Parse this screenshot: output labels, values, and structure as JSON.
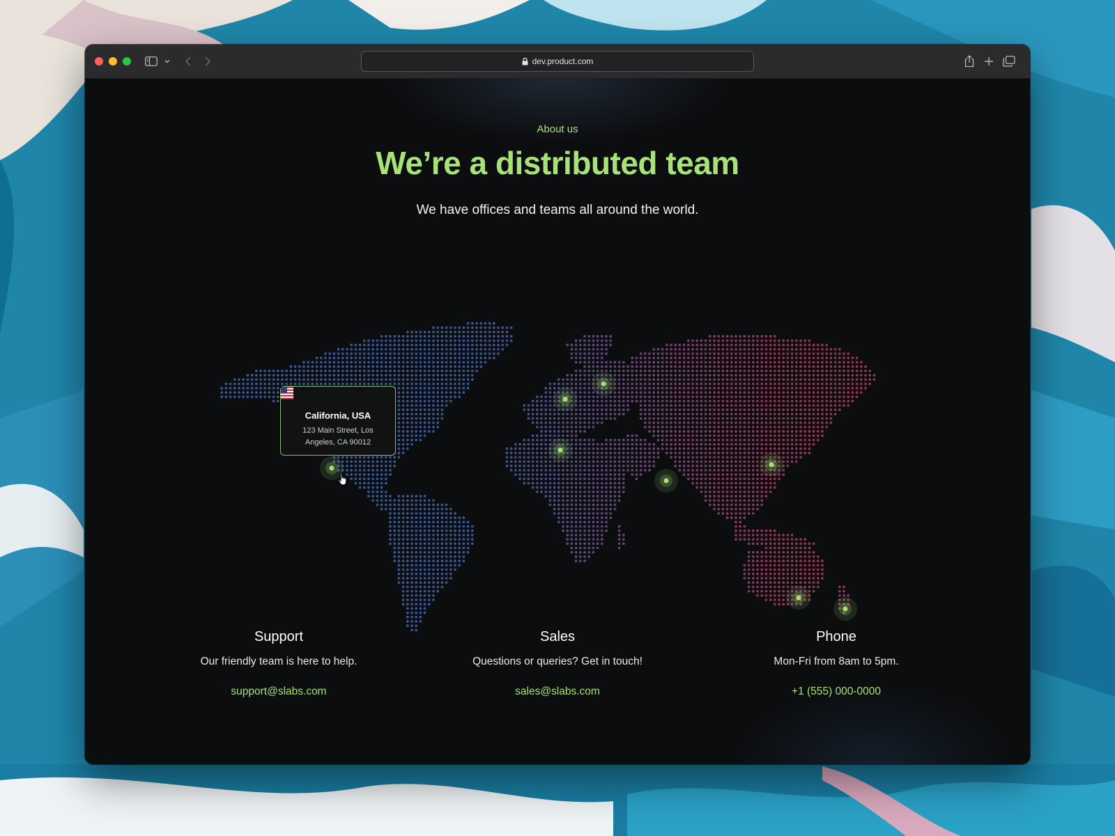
{
  "browser": {
    "url": "dev.product.com"
  },
  "hero": {
    "eyebrow": "About us",
    "title": "We’re a distributed team",
    "subtitle": "We have offices and teams all around the world."
  },
  "map": {
    "colors": {
      "west": "#3c5d9e",
      "east": "#9a3a5c",
      "marker": "#a6e278"
    },
    "tooltip": {
      "flag_icon": "us-flag-icon",
      "city": "California, USA",
      "address": "123 Main Street, Los Angeles, CA 90012"
    },
    "offices": [
      {
        "id": "california"
      },
      {
        "id": "uk"
      },
      {
        "id": "scandinavia"
      },
      {
        "id": "spain"
      },
      {
        "id": "india"
      },
      {
        "id": "china"
      },
      {
        "id": "australia"
      },
      {
        "id": "new-zealand"
      }
    ]
  },
  "contacts": [
    {
      "title": "Support",
      "description": "Our friendly team is here to help.",
      "link": "support@slabs.com"
    },
    {
      "title": "Sales",
      "description": "Questions or queries? Get in touch!",
      "link": "sales@slabs.com"
    },
    {
      "title": "Phone",
      "description": "Mon-Fri from 8am to 5pm.",
      "link": "+1 (555) 000-0000"
    }
  ]
}
